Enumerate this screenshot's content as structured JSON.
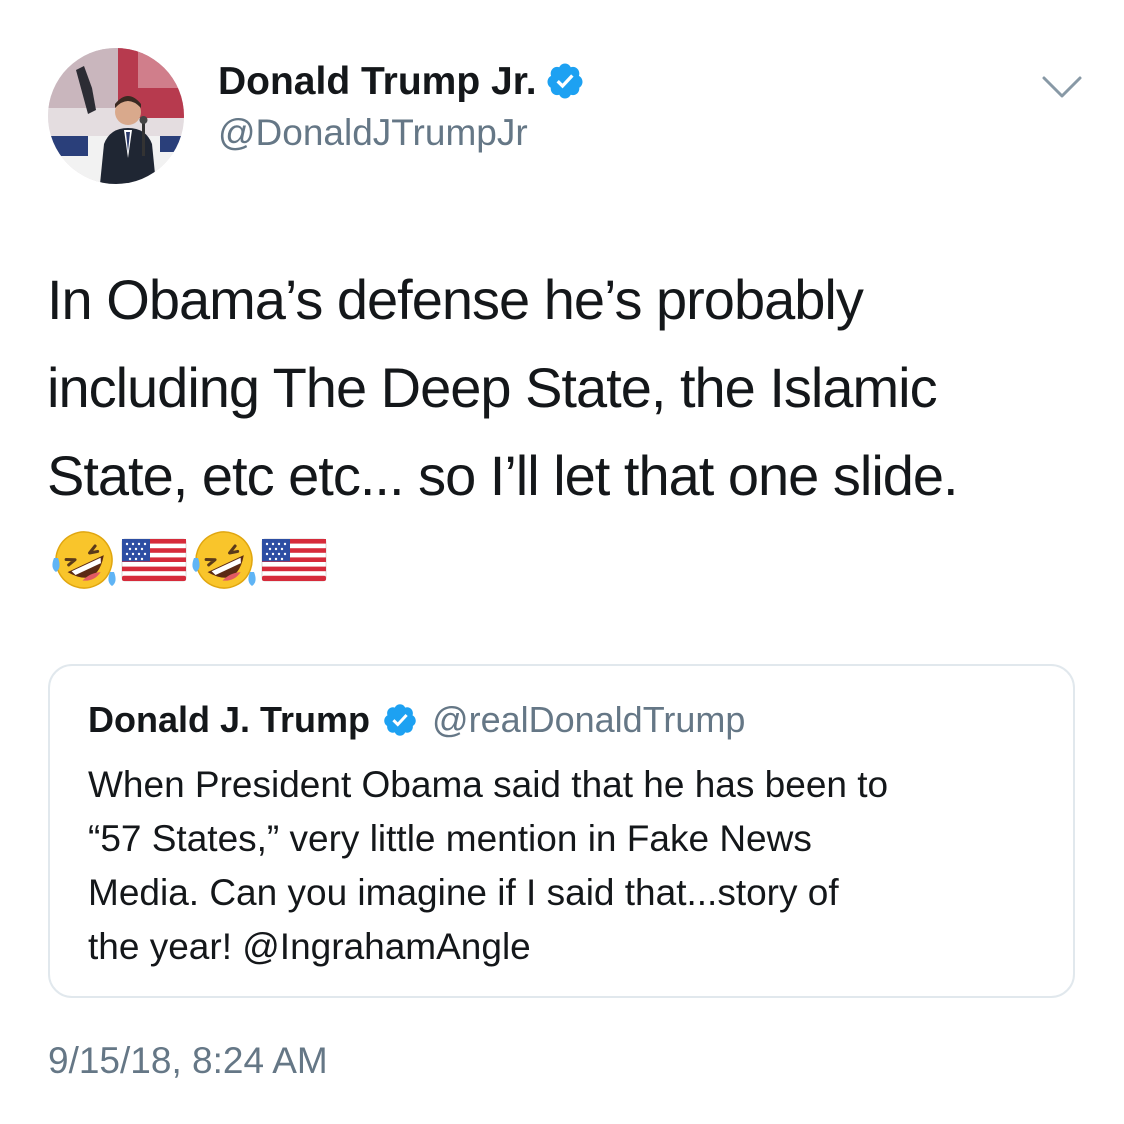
{
  "author": {
    "display_name": "Donald Trump Jr.",
    "handle": "@DonaldJTrumpJr",
    "verified": true,
    "avatar_icon": "profile-photo"
  },
  "menu": {
    "icon": "chevron-down-icon"
  },
  "tweet": {
    "text_lines": [
      "In Obama’s defense he’s probably",
      "including The Deep State, the Islamic",
      "State, etc etc... so I’ll let that one slide."
    ],
    "emojis": [
      "rolling-on-floor-laughing",
      "us-flag",
      "rolling-on-floor-laughing",
      "us-flag"
    ]
  },
  "quoted_tweet": {
    "display_name": "Donald J. Trump",
    "handle": "@realDonaldTrump",
    "verified": true,
    "text_lines": [
      "When President Obama said that he has been to",
      "“57 States,” very little mention in Fake News",
      "Media. Can you imagine if I said that...story of",
      "the year! @IngrahamAngle"
    ]
  },
  "timestamp": "9/15/18, 8:24 AM",
  "colors": {
    "text": "#14171a",
    "secondary": "#657786",
    "verified_blue": "#1da1f2",
    "border": "#e1e8ed"
  }
}
